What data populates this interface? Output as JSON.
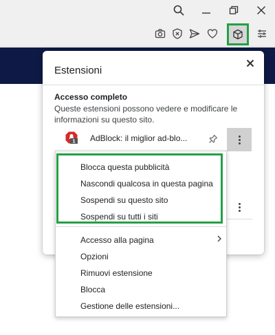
{
  "popup": {
    "title": "Estensioni",
    "section_title": "Accesso completo",
    "section_desc": "Queste estensioni possono vedere e modificare le informazioni su questo sito."
  },
  "extension": {
    "name": "AdBlock: il miglior ad-blo...",
    "badge": "1"
  },
  "context_menu": {
    "items_top": [
      "Blocca questa pubblicità",
      "Nascondi qualcosa in questa pagina",
      "Sospendi su questo sito",
      "Sospendi su tutti i siti"
    ],
    "items_bottom": [
      "Accesso alla pagina",
      "Opzioni",
      "Rimuovi estensione",
      "Blocca",
      "Gestione delle estensioni..."
    ]
  },
  "colors": {
    "highlight": "#22a045",
    "banner": "#0e1a45"
  },
  "icons": {
    "toolbar": [
      "camera-icon",
      "shield-x-icon",
      "send-icon",
      "heart-icon",
      "extensions-cube-icon",
      "sidebar-settings-icon"
    ],
    "window": [
      "search-icon",
      "minimize-icon",
      "restore-icon",
      "close-icon"
    ]
  }
}
